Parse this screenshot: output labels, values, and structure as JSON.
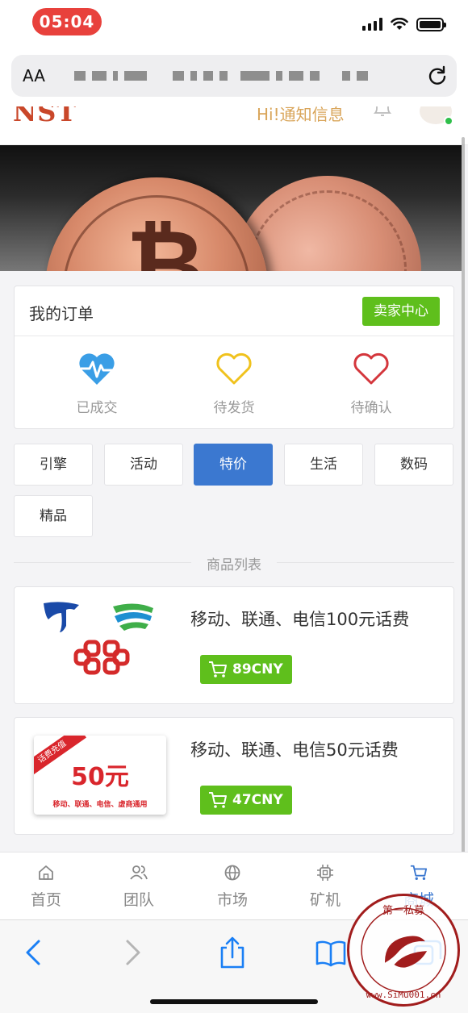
{
  "status_bar": {
    "time": "05:04"
  },
  "browser": {
    "aa_label": "AA"
  },
  "site_header": {
    "logo": "NST",
    "notice": "Hi!通知信息"
  },
  "orders": {
    "title": "我的订单",
    "seller_button": "卖家中心",
    "items": [
      {
        "label": "已成交",
        "icon": "heart-pulse-icon",
        "color": "#3a9ee6"
      },
      {
        "label": "待发货",
        "icon": "heart-outline-icon",
        "color": "#f0c21d"
      },
      {
        "label": "待确认",
        "icon": "heart-outline-icon",
        "color": "#d4363c"
      }
    ]
  },
  "categories": [
    {
      "label": "引擎",
      "active": false
    },
    {
      "label": "活动",
      "active": false
    },
    {
      "label": "特价",
      "active": true
    },
    {
      "label": "生活",
      "active": false
    },
    {
      "label": "数码",
      "active": false
    },
    {
      "label": "精品",
      "active": false
    }
  ],
  "product_list": {
    "header": "商品列表",
    "items": [
      {
        "title": "移动、联通、电信100元话费",
        "price": "89CNY"
      },
      {
        "title": "移动、联通、电信50元话费",
        "price": "47CNY",
        "card": {
          "ribbon": "话费充值",
          "amount": "50元",
          "subtitle": "移动、联通、电信、虚商通用"
        }
      }
    ]
  },
  "tabs": [
    {
      "label": "首页",
      "icon": "home-icon",
      "active": false
    },
    {
      "label": "团队",
      "icon": "team-icon",
      "active": false
    },
    {
      "label": "市场",
      "icon": "globe-icon",
      "active": false
    },
    {
      "label": "矿机",
      "icon": "chip-icon",
      "active": false
    },
    {
      "label": "商城",
      "icon": "cart-icon",
      "active": true
    }
  ],
  "watermark": {
    "text": "www.SiMu001.cn",
    "title": "第一私募"
  },
  "colors": {
    "accent_green": "#5fbf1c",
    "accent_blue": "#3b78d0",
    "safari_blue": "#1a7ff5"
  }
}
